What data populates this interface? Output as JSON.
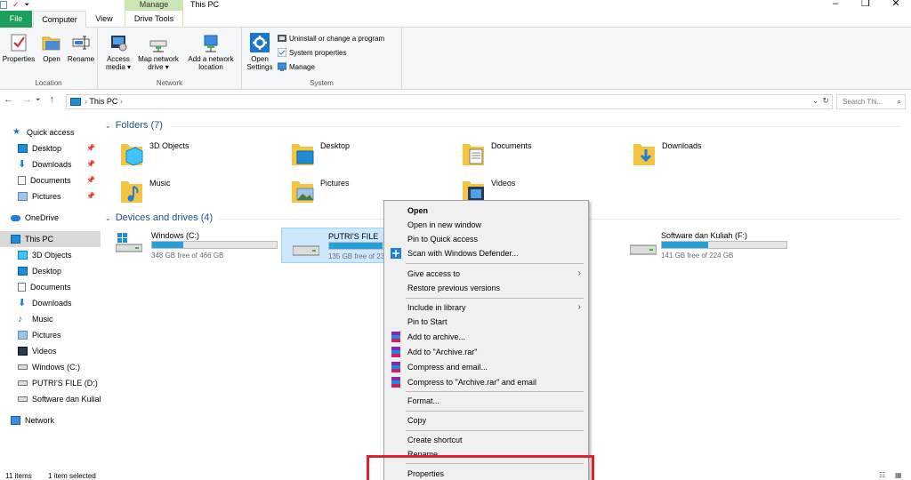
{
  "titlebar": {
    "manage_label": "Manage",
    "window_title": "This PC"
  },
  "tabs": {
    "file": "File",
    "computer": "Computer",
    "view": "View",
    "drive_tools": "Drive Tools"
  },
  "ribbon": {
    "location": {
      "label": "Location",
      "properties": "Properties",
      "open": "Open",
      "rename": "Rename"
    },
    "network": {
      "label": "Network",
      "access_media_1": "Access",
      "access_media_2": "media ▾",
      "map_drive_1": "Map network",
      "map_drive_2": "drive ▾",
      "add_location_1": "Add a network",
      "add_location_2": "location"
    },
    "system": {
      "label": "System",
      "open_settings_1": "Open",
      "open_settings_2": "Settings",
      "uninstall": "Uninstall or change a program",
      "sys_props": "System properties",
      "manage": "Manage"
    }
  },
  "address": {
    "crumb": "This PC",
    "search_placeholder": "Search Thi..."
  },
  "sidebar": {
    "items": [
      {
        "label": "Quick access",
        "icon": "star-icon"
      },
      {
        "label": "Desktop",
        "icon": "desktop-icon",
        "pinned": true
      },
      {
        "label": "Downloads",
        "icon": "download-icon",
        "pinned": true
      },
      {
        "label": "Documents",
        "icon": "document-icon",
        "pinned": true
      },
      {
        "label": "Pictures",
        "icon": "pictures-icon",
        "pinned": true
      },
      {
        "label": "OneDrive",
        "icon": "cloud-icon"
      },
      {
        "label": "This PC",
        "icon": "computer-icon",
        "selected": true
      },
      {
        "label": "3D Objects",
        "icon": "cube-icon"
      },
      {
        "label": "Desktop",
        "icon": "desktop-icon"
      },
      {
        "label": "Documents",
        "icon": "document-icon"
      },
      {
        "label": "Downloads",
        "icon": "download-icon"
      },
      {
        "label": "Music",
        "icon": "music-icon"
      },
      {
        "label": "Pictures",
        "icon": "pictures-icon"
      },
      {
        "label": "Videos",
        "icon": "videos-icon"
      },
      {
        "label": "Windows (C:)",
        "icon": "drive-c-icon"
      },
      {
        "label": "PUTRI'S FILE (D:)",
        "icon": "drive-icon"
      },
      {
        "label": "Software dan Kuliah",
        "icon": "drive-icon"
      },
      {
        "label": "Network",
        "icon": "network-icon"
      }
    ]
  },
  "content": {
    "folders_header": "Folders (7)",
    "drives_header": "Devices and drives (4)",
    "folders": [
      {
        "name": "3D Objects"
      },
      {
        "name": "Desktop"
      },
      {
        "name": "Documents"
      },
      {
        "name": "Downloads"
      },
      {
        "name": "Music"
      },
      {
        "name": "Pictures"
      },
      {
        "name": "Videos"
      }
    ],
    "drives": [
      {
        "name": "Windows (C:)",
        "free": "348 GB free of 466 GB",
        "used_fraction": 0.25
      },
      {
        "name": "PUTRI'S FILE (D:)",
        "free": "135 GB free of 239",
        "used_fraction": 0.43
      },
      {
        "name": "Software dan Kuliah (F:)",
        "free": "141 GB free of 224 GB",
        "used_fraction": 0.37
      }
    ]
  },
  "status": {
    "items": "11 items",
    "selected": "1 item selected"
  },
  "context_menu": {
    "open": "Open",
    "open_new_window": "Open in new window",
    "pin_quick": "Pin to Quick access",
    "scan": "Scan with Windows Defender...",
    "give_access": "Give access to",
    "restore": "Restore previous versions",
    "include_library": "Include in library",
    "pin_start": "Pin to Start",
    "add_archive": "Add to archive...",
    "add_rar": "Add to \"Archive.rar\"",
    "compress_email": "Compress and email...",
    "compress_rar_email": "Compress to \"Archive.rar\" and email",
    "format": "Format...",
    "copy": "Copy",
    "create_shortcut": "Create shortcut",
    "rename": "Rename",
    "properties": "Properties"
  },
  "colors": {
    "accent": "#1e4e8c",
    "file_tab": "#19a05a",
    "manage_tab": "#c9e6b4",
    "drive_bar": "#26a0da",
    "highlight": "#e0202e"
  }
}
